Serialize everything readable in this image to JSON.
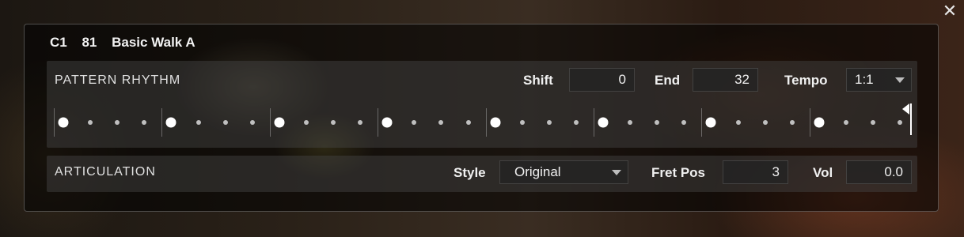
{
  "close_label": "✕",
  "preset": {
    "note": "C1",
    "number": "81",
    "name": "Basic Walk A"
  },
  "pattern_rhythm": {
    "title": "PATTERN RHYTHM",
    "shift_label": "Shift",
    "shift_value": "0",
    "end_label": "End",
    "end_value": "32",
    "tempo_label": "Tempo",
    "tempo_value": "1:1",
    "steps": {
      "count": 32,
      "active": [
        1,
        5,
        9,
        13,
        17,
        21,
        25,
        29
      ],
      "end": 32
    }
  },
  "articulation": {
    "title": "ARTICULATION",
    "style_label": "Style",
    "style_value": "Original",
    "fretpos_label": "Fret Pos",
    "fretpos_value": "3",
    "vol_label": "Vol",
    "vol_value": "0.0"
  },
  "colors": {
    "active_step": "#ffffff",
    "inactive_step": "#bfbfbf"
  }
}
